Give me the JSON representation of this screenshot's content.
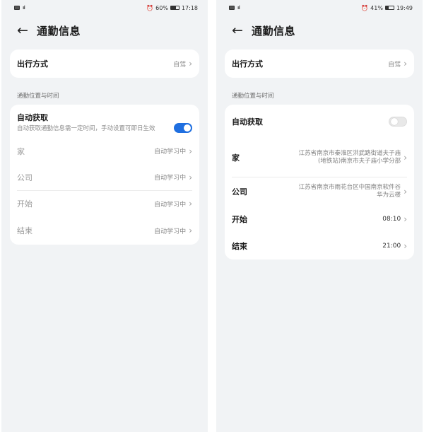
{
  "left": {
    "status": {
      "battery": "60%",
      "time": "17:18",
      "battery_level": 0.6
    },
    "header": {
      "title": "通勤信息"
    },
    "travel": {
      "label": "出行方式",
      "value": "自驾"
    },
    "section_label": "通勤位置与时间",
    "auto": {
      "label": "自动获取",
      "desc": "自动获取通勤信息需一定时间，手动设置可即日生效",
      "enabled": true
    },
    "rows": [
      {
        "label": "家",
        "value": "自动学习中"
      },
      {
        "label": "公司",
        "value": "自动学习中"
      },
      {
        "label": "开始",
        "value": "自动学习中"
      },
      {
        "label": "结束",
        "value": "自动学习中"
      }
    ]
  },
  "right": {
    "status": {
      "battery": "41%",
      "time": "19:49",
      "battery_level": 0.41
    },
    "header": {
      "title": "通勤信息"
    },
    "travel": {
      "label": "出行方式",
      "value": "自驾"
    },
    "section_label": "通勤位置与时间",
    "auto": {
      "label": "自动获取",
      "enabled": false
    },
    "rows": [
      {
        "label": "家",
        "value": "江苏省南京市秦淮区洪武路街道夫子庙(地铁站)南京市夫子庙小学分部"
      },
      {
        "label": "公司",
        "value": "江苏省南京市雨花台区中国南京软件谷华为云楼"
      },
      {
        "label": "开始",
        "value": "08:10"
      },
      {
        "label": "结束",
        "value": "21:00"
      }
    ]
  },
  "colors": {
    "accent": "#1f6fe0",
    "background": "#f1f3f5",
    "card": "#ffffff"
  },
  "icons": {
    "back": "arrow-left-icon",
    "chevron": "chevron-right-icon",
    "alarm": "alarm-icon",
    "battery": "battery-icon"
  }
}
